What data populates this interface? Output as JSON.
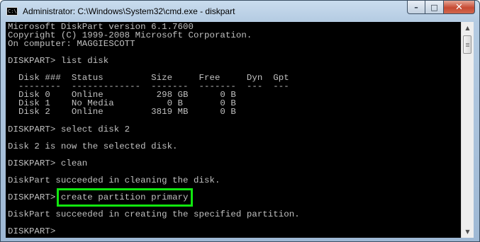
{
  "window": {
    "title": "Administrator: C:\\Windows\\System32\\cmd.exe - diskpart",
    "icon": "cmd-icon",
    "icon_text": "C:\\",
    "controls": {
      "minimize": "–",
      "maximize": "□",
      "close": "✕"
    }
  },
  "console": {
    "lines": [
      "Microsoft DiskPart version 6.1.7600",
      "Copyright (C) 1999-2008 Microsoft Corporation.",
      "On computer: MAGGIESCOTT",
      "",
      "DISKPART> list disk",
      "",
      "  Disk ###  Status         Size     Free     Dyn  Gpt",
      "  --------  -------------  -------  -------  ---  ---",
      "  Disk 0    Online          298 GB      0 B",
      "  Disk 1    No Media          0 B       0 B",
      "  Disk 2    Online         3819 MB      0 B",
      "",
      "DISKPART> select disk 2",
      "",
      "Disk 2 is now the selected disk.",
      "",
      "DISKPART> clean",
      "",
      "DiskPart succeeded in cleaning the disk.",
      "",
      "DISKPART>",
      "",
      "DiskPart succeeded in creating the specified partition.",
      "",
      "DISKPART>"
    ],
    "highlighted_command": "create partition primary",
    "highlight_color": "#11e60f",
    "text_color": "#c0c0c0",
    "background_color": "#000000"
  },
  "scrollbar": {
    "up_arrow": "▲",
    "down_arrow": "▼"
  }
}
